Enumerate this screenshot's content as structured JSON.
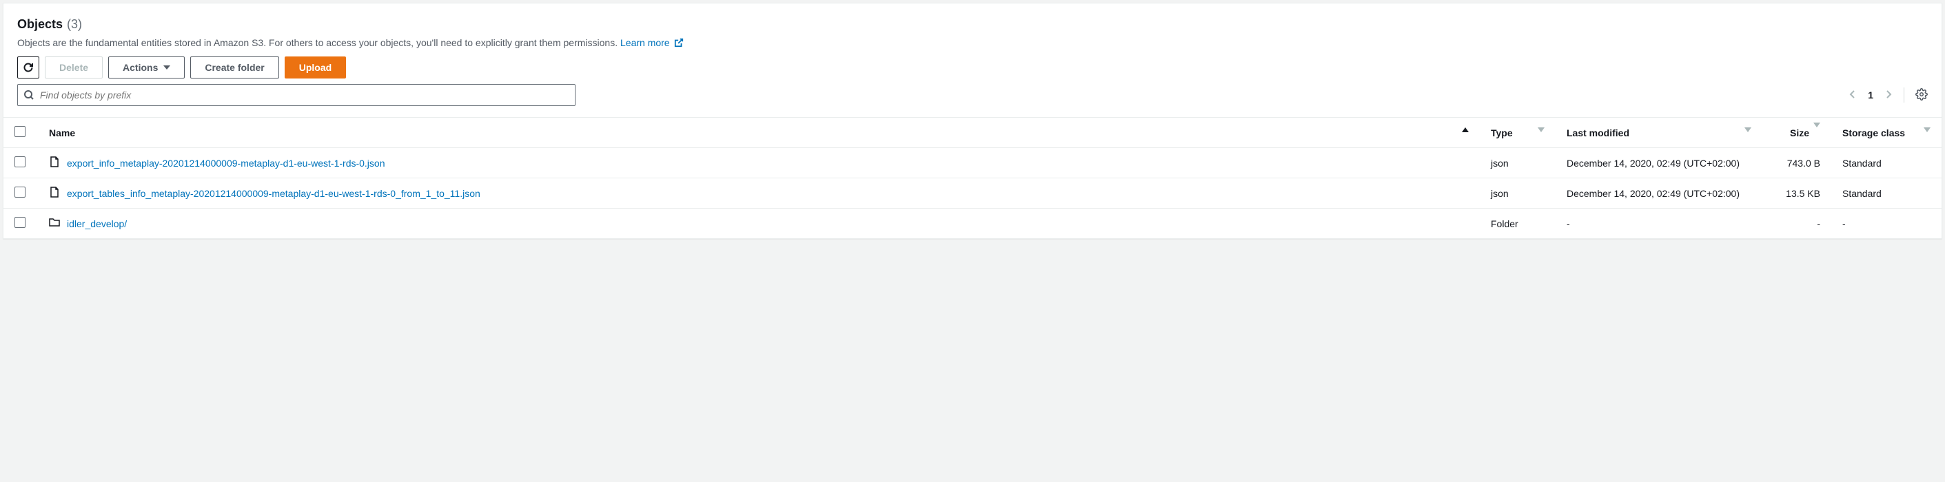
{
  "header": {
    "title": "Objects",
    "count": "(3)",
    "description": "Objects are the fundamental entities stored in Amazon S3. For others to access your objects, you'll need to explicitly grant them permissions.",
    "learn_more": "Learn more"
  },
  "toolbar": {
    "delete": "Delete",
    "actions": "Actions",
    "create_folder": "Create folder",
    "upload": "Upload"
  },
  "search": {
    "placeholder": "Find objects by prefix"
  },
  "pagination": {
    "page": "1"
  },
  "columns": {
    "name": "Name",
    "type": "Type",
    "modified": "Last modified",
    "size": "Size",
    "storage": "Storage class"
  },
  "objects": [
    {
      "icon": "file",
      "name": "export_info_metaplay-20201214000009-metaplay-d1-eu-west-1-rds-0.json",
      "type": "json",
      "modified": "December 14, 2020, 02:49 (UTC+02:00)",
      "size": "743.0 B",
      "storage": "Standard"
    },
    {
      "icon": "file",
      "name": "export_tables_info_metaplay-20201214000009-metaplay-d1-eu-west-1-rds-0_from_1_to_11.json",
      "type": "json",
      "modified": "December 14, 2020, 02:49 (UTC+02:00)",
      "size": "13.5 KB",
      "storage": "Standard"
    },
    {
      "icon": "folder",
      "name": "idler_develop/",
      "type": "Folder",
      "modified": "-",
      "size": "-",
      "storage": "-"
    }
  ]
}
